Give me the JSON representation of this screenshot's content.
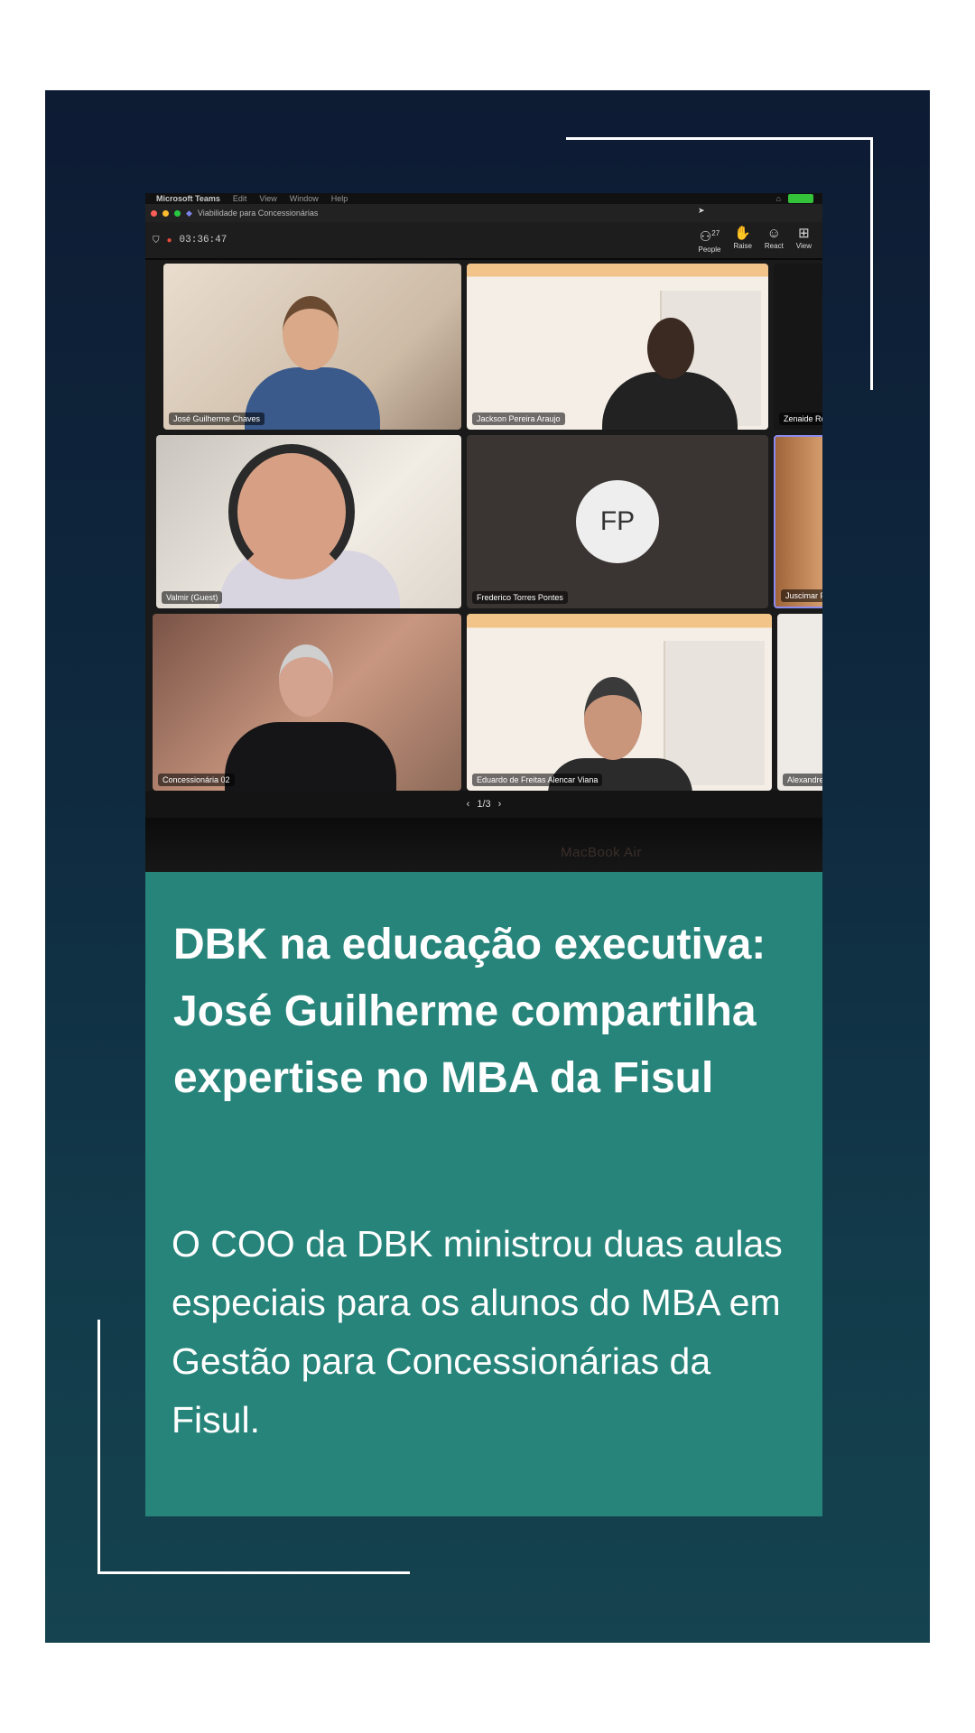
{
  "meeting": {
    "menubar": [
      "Microsoft Teams",
      "Edit",
      "View",
      "Window",
      "Help"
    ],
    "window_title": "Viabilidade para Concessionárias",
    "timer": "03:36:47",
    "people_count": "27",
    "tools": [
      {
        "icon": "people-icon",
        "label": "People"
      },
      {
        "icon": "raise-hand-icon",
        "label": "Raise"
      },
      {
        "icon": "react-icon",
        "label": "React"
      },
      {
        "icon": "view-icon",
        "label": "View"
      }
    ],
    "participants": [
      "José Guilherme Chaves",
      "Jackson Pereira Araujo",
      "Zenaide Ro",
      "Valmir (Guest)",
      "Frederico Torres Pontes",
      "Juscimar F",
      "Concessionária 02",
      "Eduardo de Freitas Alencar Viana",
      "Alexandre"
    ],
    "avatar_initials": "FP",
    "pager": "1/3",
    "device_label": "MacBook Air"
  },
  "post": {
    "headline": "DBK na educação executiva: José Guilherme compartilha expertise no MBA da Fisul",
    "summary": "O COO da DBK ministrou duas aulas especiais para os alunos do MBA em Gestão para Concessionárias da Fisul."
  }
}
